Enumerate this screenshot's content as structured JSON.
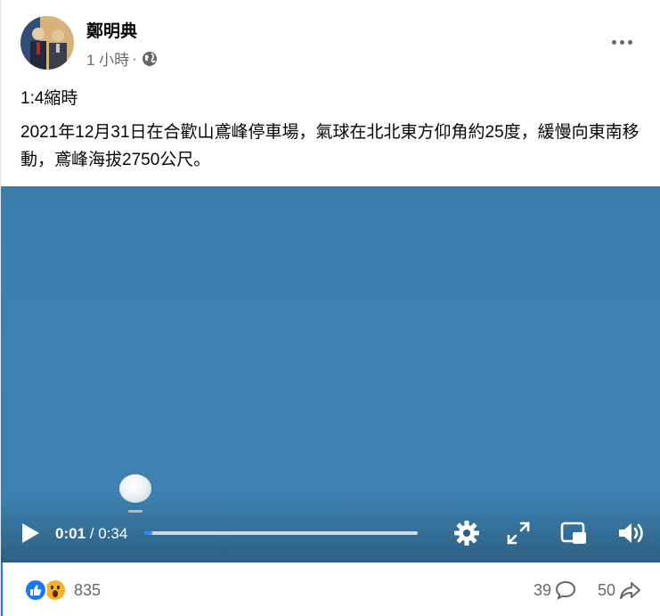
{
  "post": {
    "author": "鄭明典",
    "time": "1 小時",
    "time_sep": "·",
    "privacy_icon": "globe-icon",
    "title_line": "1:4縮時",
    "text": "2021年12月31日在合歡山鳶峰停車場，氣球在北北東方仰角約25度，緩慢向東南移動，鳶峰海拔2750公尺。"
  },
  "video": {
    "current_time": "0:01",
    "separator": " / ",
    "duration": "0:34",
    "progress": 0.03,
    "icons": [
      "play-icon",
      "settings-icon",
      "fullscreen-icon",
      "picture-in-picture-icon",
      "volume-icon"
    ]
  },
  "footer": {
    "reaction_count": "835",
    "comment_count": "39",
    "share_count": "50"
  },
  "colors": {
    "accent": "#1877f2",
    "sky": "#3b7eae",
    "wow": "#f7b125",
    "muted": "#65676b"
  }
}
